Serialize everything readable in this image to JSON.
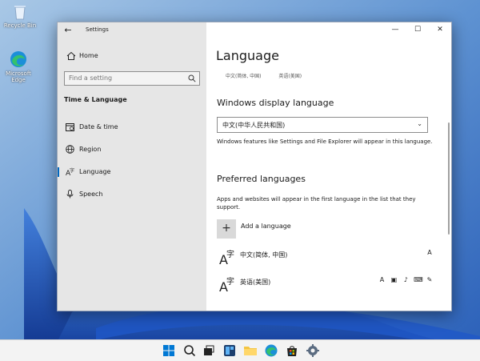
{
  "desktop": {
    "icons": [
      {
        "label": "Recycle Bin",
        "icon": "recycle-bin-icon"
      },
      {
        "label": "Microsoft Edge",
        "icon": "edge-icon"
      }
    ]
  },
  "window": {
    "app_title": "Settings",
    "back_icon": "back-arrow-icon",
    "caption": {
      "minimize": "minimize-icon",
      "maximize": "maximize-icon",
      "close": "close-icon"
    }
  },
  "sidebar": {
    "home_label": "Home",
    "search_placeholder": "Find a setting",
    "section_title": "Time & Language",
    "items": [
      {
        "label": "Date & time",
        "icon": "calendar-icon"
      },
      {
        "label": "Region",
        "icon": "globe-icon"
      },
      {
        "label": "Language",
        "icon": "language-icon",
        "selected": true
      },
      {
        "label": "Speech",
        "icon": "microphone-icon"
      }
    ]
  },
  "main": {
    "title": "Language",
    "quick_links": [
      "中文(简体, 中国)",
      "英语(美国)"
    ],
    "display_language": {
      "heading": "Windows display language",
      "selected": "中文(中华人民共和国)",
      "description": "Windows features like Settings and File Explorer will appear in this language."
    },
    "preferred": {
      "heading": "Preferred languages",
      "description": "Apps and websites will appear in the first language in the list that they support.",
      "add_label": "Add a language",
      "languages": [
        {
          "label": "中文(简体, 中国)",
          "features": [
            "display-language-icon"
          ]
        },
        {
          "label": "英语(美国)",
          "features": [
            "display-language-icon",
            "speech-icon",
            "microphone-icon",
            "keyboard-icon",
            "handwriting-icon"
          ]
        }
      ]
    }
  },
  "taskbar": {
    "items": [
      "start-icon",
      "search-icon",
      "task-view-icon",
      "widgets-icon",
      "file-explorer-icon",
      "edge-icon",
      "store-icon",
      "settings-icon"
    ]
  },
  "colors": {
    "accent": "#0067c0",
    "sidebar_bg": "#e6e6e6",
    "wallpaper": "#2a5fb8"
  }
}
